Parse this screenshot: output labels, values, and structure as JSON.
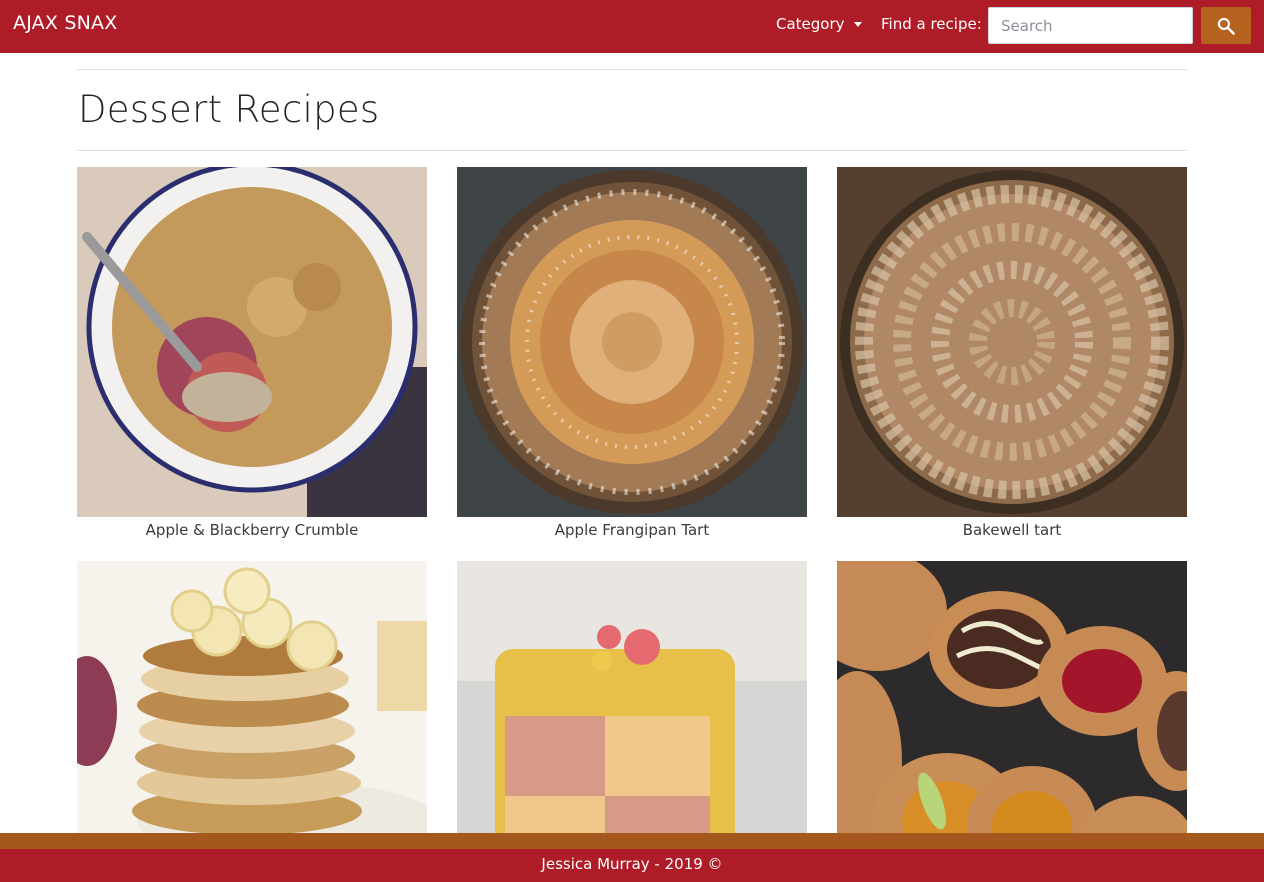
{
  "navbar": {
    "brand": "AJAX SNAX",
    "category_label": "Category",
    "find_label": "Find a recipe:",
    "search_placeholder": "Search",
    "search_icon": "search-icon",
    "bg_color": "#ae1c28",
    "button_color": "#b5621f"
  },
  "page": {
    "title": "Dessert Recipes"
  },
  "recipes": [
    {
      "name": "Apple & Blackberry Crumble",
      "image": "crumble-photo"
    },
    {
      "name": "Apple Frangipan Tart",
      "image": "apple-tart-photo"
    },
    {
      "name": "Bakewell tart",
      "image": "bakewell-tart-photo"
    },
    {
      "name": "",
      "image": "banana-pancakes-photo"
    },
    {
      "name": "",
      "image": "battenberg-cake-photo"
    },
    {
      "name": "",
      "image": "pastries-photo"
    }
  ],
  "footer": {
    "text": "Jessica Murray - 2019 ©"
  }
}
